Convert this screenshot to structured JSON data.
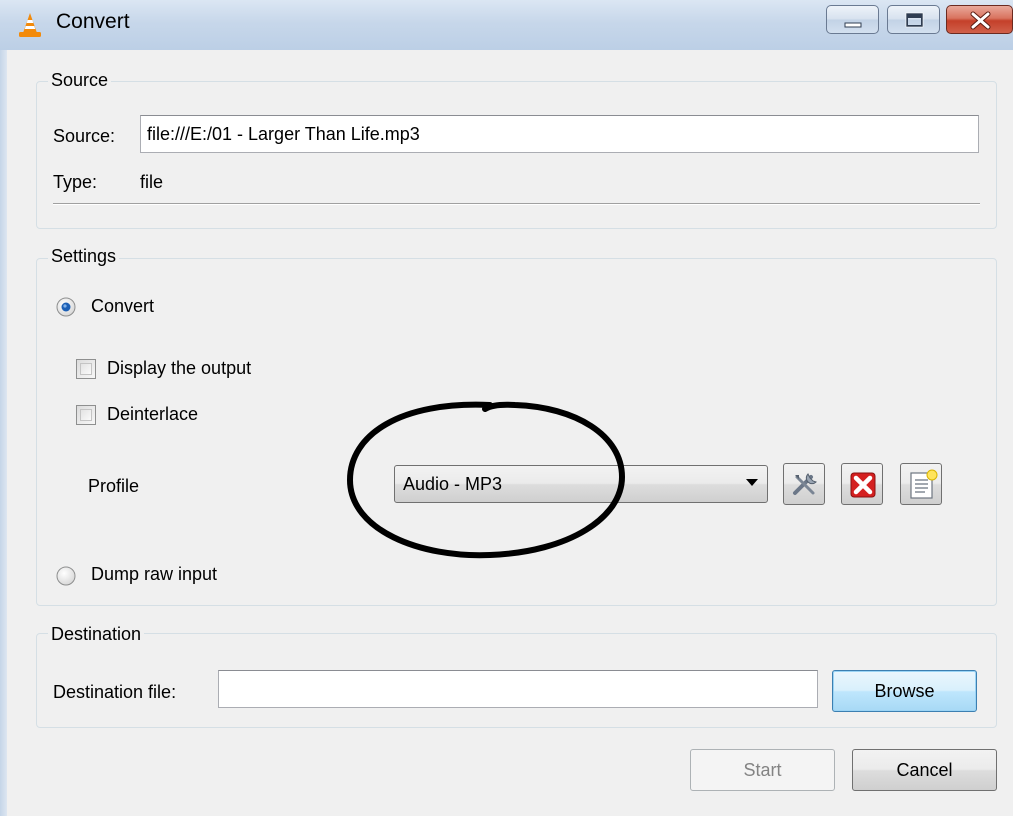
{
  "window": {
    "title": "Convert",
    "app_icon": "vlc-cone-icon"
  },
  "source_group": {
    "legend": "Source",
    "source_label": "Source:",
    "source_value": "file:///E:/01 - Larger Than Life.mp3",
    "type_label": "Type:",
    "type_value": "file"
  },
  "settings_group": {
    "legend": "Settings",
    "convert_label": "Convert",
    "convert_selected": true,
    "display_output_label": "Display the output",
    "display_output_checked": false,
    "deinterlace_label": "Deinterlace",
    "deinterlace_checked": false,
    "profile_label": "Profile",
    "profile_selected": "Audio - MP3",
    "profile_tools": [
      "edit-profile-icon",
      "delete-profile-icon",
      "new-profile-icon"
    ],
    "dump_raw_label": "Dump raw input",
    "dump_raw_selected": false
  },
  "destination_group": {
    "legend": "Destination",
    "destination_label": "Destination file:",
    "destination_value": "",
    "browse_label": "Browse"
  },
  "footer": {
    "start_label": "Start",
    "cancel_label": "Cancel"
  },
  "colors": {
    "annotation": "#000000",
    "delete_red": "#d42020",
    "radio_selected": "#1c5fb5"
  }
}
